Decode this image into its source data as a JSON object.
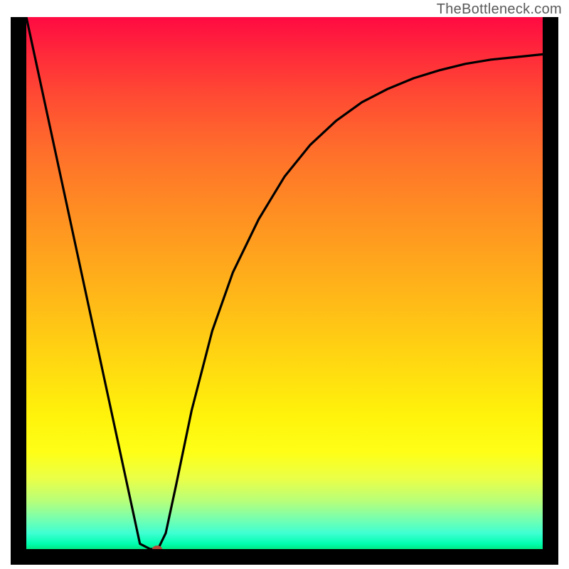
{
  "watermark": "TheBottleneck.com",
  "chart_data": {
    "type": "line",
    "title": "",
    "xlabel": "",
    "ylabel": "",
    "xlim": [
      0,
      100
    ],
    "ylim": [
      0,
      100
    ],
    "grid": false,
    "legend": false,
    "background_gradient": {
      "orientation": "vertical",
      "stops": [
        {
          "pos": 0.0,
          "color": "#ff0a42"
        },
        {
          "pos": 0.5,
          "color": "#ffb11a"
        },
        {
          "pos": 0.82,
          "color": "#feff18"
        },
        {
          "pos": 1.0,
          "color": "#00e884"
        }
      ]
    },
    "series": [
      {
        "name": "bottleneck-curve",
        "color": "#000000",
        "x": [
          0.0,
          5.0,
          10.0,
          15.0,
          20.0,
          22.0,
          24.0,
          25.5,
          27.0,
          29.0,
          32.0,
          36.0,
          40.0,
          45.0,
          50.0,
          55.0,
          60.0,
          65.0,
          70.0,
          75.0,
          80.0,
          85.0,
          90.0,
          95.0,
          100.0
        ],
        "y": [
          100.0,
          77.5,
          55.0,
          32.5,
          10.0,
          1.0,
          0.0,
          0.0,
          3.0,
          12.0,
          26.0,
          41.0,
          52.0,
          62.0,
          70.0,
          76.0,
          80.5,
          84.0,
          86.5,
          88.5,
          90.0,
          91.2,
          92.0,
          92.5,
          93.0
        ]
      }
    ],
    "marker": {
      "x": 25.4,
      "y": 0.0,
      "color": "#b44a3a"
    }
  }
}
